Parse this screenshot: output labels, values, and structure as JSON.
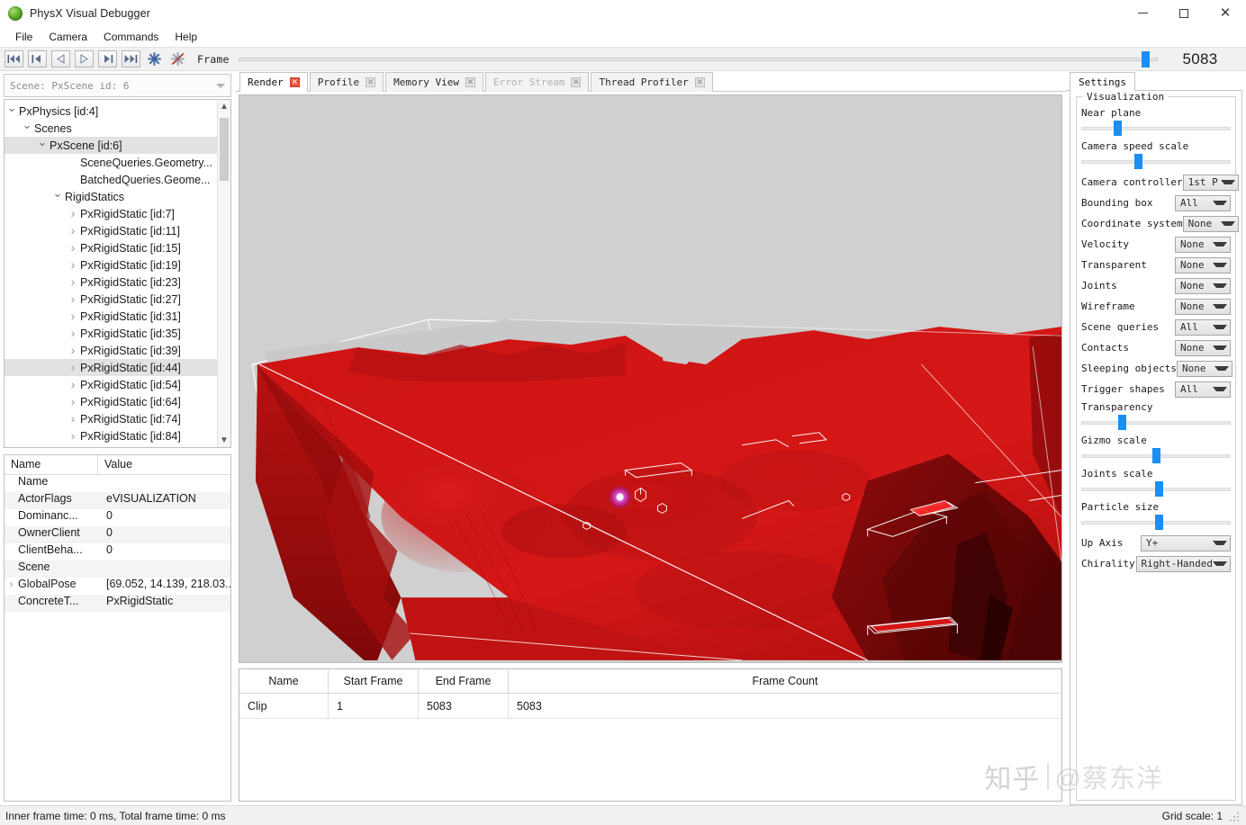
{
  "window": {
    "title": "PhysX Visual Debugger",
    "icon": "physx-sphere-icon",
    "minimize": "—",
    "maximize": "□",
    "close": "✕"
  },
  "menubar": {
    "items": [
      {
        "label": "File"
      },
      {
        "label": "Camera"
      },
      {
        "label": "Commands"
      },
      {
        "label": "Help"
      }
    ]
  },
  "toolbar": {
    "buttons": [
      {
        "name": "go-to-start-button",
        "icon": "skip-to-start-icon"
      },
      {
        "name": "step-back-button",
        "icon": "previous-frame-icon"
      },
      {
        "name": "play-reverse-button",
        "icon": "play-reverse-icon"
      },
      {
        "name": "play-button",
        "icon": "play-icon"
      },
      {
        "name": "step-forward-button",
        "icon": "next-frame-icon"
      },
      {
        "name": "go-to-end-button",
        "icon": "skip-to-end-icon"
      },
      {
        "name": "connect-button",
        "icon": "connect-asterisk-icon"
      },
      {
        "name": "disconnect-button",
        "icon": "disconnect-asterisk-icon"
      }
    ],
    "frame_label": "Frame",
    "frame_value": "5083"
  },
  "left_panel": {
    "scene_combo": {
      "value": "Scene: PxScene id: 6"
    },
    "tree": {
      "items": [
        {
          "label": "PxPhysics [id:4]",
          "depth": 0,
          "state": "open",
          "selected": false
        },
        {
          "label": "Scenes",
          "depth": 1,
          "state": "open",
          "selected": false
        },
        {
          "label": "PxScene [id:6]",
          "depth": 2,
          "state": "open",
          "selected": true
        },
        {
          "label": "SceneQueries.Geometry...",
          "depth": 4,
          "state": "none",
          "selected": false
        },
        {
          "label": "BatchedQueries.Geome...",
          "depth": 4,
          "state": "none",
          "selected": false
        },
        {
          "label": "RigidStatics",
          "depth": 3,
          "state": "open",
          "selected": false
        },
        {
          "label": "PxRigidStatic [id:7]",
          "depth": 4,
          "state": "closed",
          "selected": false
        },
        {
          "label": "PxRigidStatic [id:11]",
          "depth": 4,
          "state": "closed",
          "selected": false
        },
        {
          "label": "PxRigidStatic [id:15]",
          "depth": 4,
          "state": "closed",
          "selected": false
        },
        {
          "label": "PxRigidStatic [id:19]",
          "depth": 4,
          "state": "closed",
          "selected": false
        },
        {
          "label": "PxRigidStatic [id:23]",
          "depth": 4,
          "state": "closed",
          "selected": false
        },
        {
          "label": "PxRigidStatic [id:27]",
          "depth": 4,
          "state": "closed",
          "selected": false
        },
        {
          "label": "PxRigidStatic [id:31]",
          "depth": 4,
          "state": "closed",
          "selected": false
        },
        {
          "label": "PxRigidStatic [id:35]",
          "depth": 4,
          "state": "closed",
          "selected": false
        },
        {
          "label": "PxRigidStatic [id:39]",
          "depth": 4,
          "state": "closed",
          "selected": false
        },
        {
          "label": "PxRigidStatic [id:44]",
          "depth": 4,
          "state": "closed",
          "selected": true
        },
        {
          "label": "PxRigidStatic [id:54]",
          "depth": 4,
          "state": "closed",
          "selected": false
        },
        {
          "label": "PxRigidStatic [id:64]",
          "depth": 4,
          "state": "closed",
          "selected": false
        },
        {
          "label": "PxRigidStatic [id:74]",
          "depth": 4,
          "state": "closed",
          "selected": false
        },
        {
          "label": "PxRigidStatic [id:84]",
          "depth": 4,
          "state": "closed",
          "selected": false
        }
      ]
    },
    "properties": {
      "headers": {
        "name": "Name",
        "value": "Value"
      },
      "rows": [
        {
          "name": "Name",
          "value": "",
          "expandable": false
        },
        {
          "name": "ActorFlags",
          "value": "eVISUALIZATION",
          "expandable": false
        },
        {
          "name": "Dominanc...",
          "value": "0",
          "expandable": false
        },
        {
          "name": "OwnerClient",
          "value": "0",
          "expandable": false
        },
        {
          "name": "ClientBeha...",
          "value": "0",
          "expandable": false
        },
        {
          "name": "Scene",
          "value": "",
          "expandable": false
        },
        {
          "name": "GlobalPose",
          "value": "[69.052, 14.139, 218.03...",
          "expandable": true
        },
        {
          "name": "ConcreteT...",
          "value": "PxRigidStatic",
          "expandable": false
        }
      ]
    }
  },
  "center_panel": {
    "tabs": [
      {
        "label": "Render",
        "active": true,
        "dim": false,
        "close": "✕"
      },
      {
        "label": "Profile",
        "active": false,
        "dim": false,
        "close": "✕"
      },
      {
        "label": "Memory View",
        "active": false,
        "dim": false,
        "close": "✕"
      },
      {
        "label": "Error Stream",
        "active": false,
        "dim": true,
        "close": "✕"
      },
      {
        "label": "Thread Profiler",
        "active": false,
        "dim": false,
        "close": "✕"
      }
    ],
    "viewport": {
      "name": "render-viewport",
      "background_color": "#d0d0d0",
      "terrain_color": "#cc1313",
      "wireframe_color": "#ffffff"
    },
    "clip_table": {
      "headers": [
        "Name",
        "Start Frame",
        "End Frame",
        "Frame Count"
      ],
      "rows": [
        {
          "name": "Clip",
          "start_frame": "1",
          "end_frame": "5083",
          "frame_count": "5083"
        }
      ]
    }
  },
  "right_panel": {
    "tab_label": "Settings",
    "group_title": "Visualization",
    "sliders": [
      {
        "label": "Near plane",
        "percent": 24
      },
      {
        "label": "Camera speed scale",
        "percent": 38
      },
      {
        "label": "Transparency",
        "percent": 27
      },
      {
        "label": "Gizmo scale",
        "percent": 50
      },
      {
        "label": "Joints scale",
        "percent": 52
      },
      {
        "label": "Particle size",
        "percent": 52
      }
    ],
    "dropdowns": [
      {
        "label": "Camera controller",
        "value": "1st P"
      },
      {
        "label": "Bounding box",
        "value": "All"
      },
      {
        "label": "Coordinate system",
        "value": "None"
      },
      {
        "label": "Velocity",
        "value": "None"
      },
      {
        "label": "Transparent",
        "value": "None"
      },
      {
        "label": "Joints",
        "value": "None"
      },
      {
        "label": "Wireframe",
        "value": "None"
      },
      {
        "label": "Scene queries",
        "value": "All"
      },
      {
        "label": "Contacts",
        "value": "None"
      },
      {
        "label": "Sleeping objects",
        "value": "None"
      },
      {
        "label": "Trigger shapes",
        "value": "All"
      }
    ],
    "bottom_dropdowns": [
      {
        "label": "Up Axis",
        "value": "Y+"
      },
      {
        "label": "Chirality",
        "value": "Right-Handed"
      }
    ]
  },
  "statusbar": {
    "left": "Inner frame time: 0 ms, Total frame time: 0 ms",
    "right": "Grid scale: 1"
  },
  "watermark": {
    "logo": "知乎",
    "user": "@蔡东洋"
  },
  "colors": {
    "accent_blue": "#1b8ef2",
    "tab_close_red": "#e8503a",
    "terrain_red": "#cc1313",
    "selection_gray": "#e2e2e2"
  }
}
